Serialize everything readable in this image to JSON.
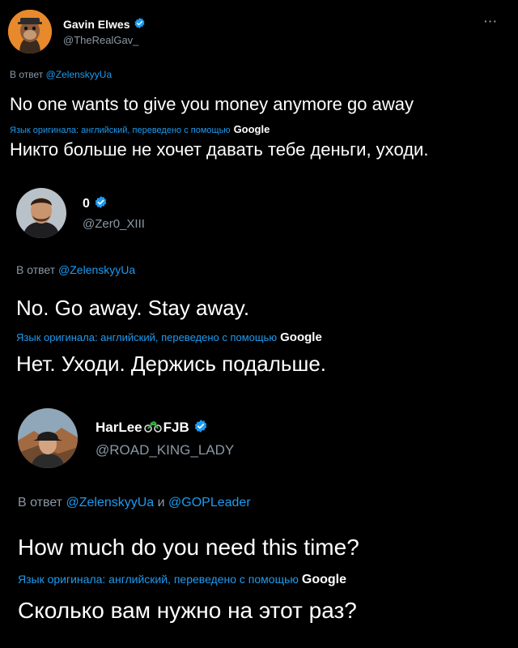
{
  "tweet1": {
    "name": "Gavin Elwes",
    "handle": "@TheRealGav_",
    "reply_prefix": "В ответ",
    "reply_to": "@ZelenskyyUa",
    "text": "No one wants to give you money anymore go away",
    "translation_note": "Язык оригинала: английский, переведено с помощью",
    "translation_service": "Google",
    "translation": "Никто больше не хочет давать тебе деньги, уходи.",
    "more": "···"
  },
  "tweet2": {
    "name": "0",
    "handle": "@Zer0_XIII",
    "reply_prefix": "В ответ",
    "reply_to": "@ZelenskyyUa",
    "text": "No. Go away. Stay away.",
    "translation_note": "Язык оригинала: английский, переведено с помощью",
    "translation_service": "Google",
    "translation": "Нет. Уходи. Держись подальше."
  },
  "tweet3": {
    "name_part1": "HarLee",
    "name_part2": "FJB",
    "handle": "@ROAD_KING_LADY",
    "reply_prefix": "В ответ",
    "reply_to": "@ZelenskyyUa",
    "reply_and": "и",
    "reply_to2": "@GOPLeader",
    "text": "How much do you need this time?",
    "translation_note": "Язык оригинала: английский, переведено с помощью",
    "translation_service": "Google",
    "translation": "Сколько вам нужно на этот раз?"
  },
  "icons": {
    "verified": "verified-badge-icon",
    "more": "more-options-icon",
    "motorcycle": "motorcycle-emoji-icon"
  },
  "colors": {
    "background": "#000000",
    "link": "#1d9bf0",
    "verified": "#1d9bf0",
    "muted": "#8b98a5"
  }
}
